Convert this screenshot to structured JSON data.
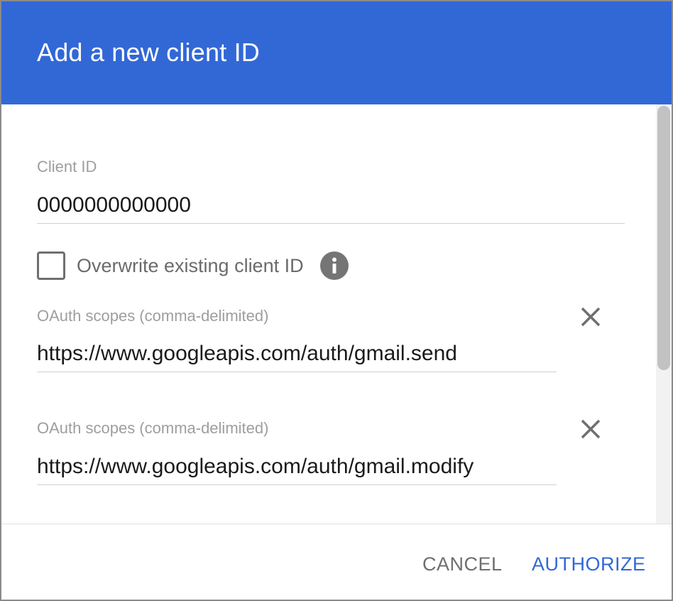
{
  "dialog": {
    "title": "Add a new client ID"
  },
  "client_id": {
    "label": "Client ID",
    "value": "0000000000000"
  },
  "overwrite": {
    "label": "Overwrite existing client ID",
    "checked": false,
    "info_icon": "info-icon"
  },
  "scopes": [
    {
      "label": "OAuth scopes (comma-delimited)",
      "value": "https://www.googleapis.com/auth/gmail.send",
      "remove_icon": "close-icon"
    },
    {
      "label": "OAuth scopes (comma-delimited)",
      "value": "https://www.googleapis.com/auth/gmail.modify",
      "remove_icon": "close-icon"
    }
  ],
  "footer": {
    "cancel_label": "CANCEL",
    "authorize_label": "AUTHORIZE"
  },
  "colors": {
    "header_bg": "#3268d6",
    "primary_button": "#3268d6",
    "secondary_button": "#6f6f6f",
    "label": "#9e9e9e"
  }
}
